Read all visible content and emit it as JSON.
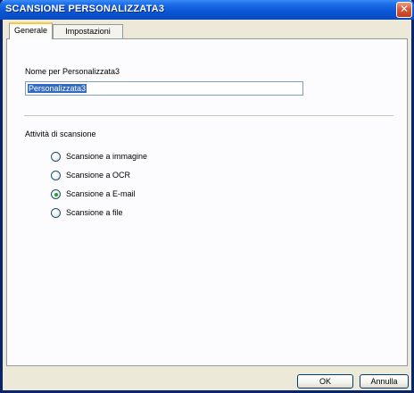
{
  "window": {
    "title": "SCANSIONE PERSONALIZZATA3",
    "close_symbol": "✕"
  },
  "tabs": [
    {
      "label": "Generale",
      "active": true
    },
    {
      "label": "Impostazioni",
      "active": false
    }
  ],
  "name_field": {
    "label": "Nome per Personalizzata3",
    "value": "Personalizzata3"
  },
  "activity": {
    "heading": "Attività di scansione",
    "options": [
      {
        "label": "Scansione a immagine",
        "selected": false
      },
      {
        "label": "Scansione a OCR",
        "selected": false
      },
      {
        "label": "Scansione a E-mail",
        "selected": true
      },
      {
        "label": "Scansione a file",
        "selected": false
      }
    ]
  },
  "buttons": {
    "ok": "OK",
    "cancel": "Annulla"
  },
  "colors": {
    "titlebar": "#0b57d8",
    "dialog_bg": "#ece9d8",
    "selection": "#316ac5",
    "radio_dot": "#21a121",
    "active_tab_accent": "#ffc83c"
  }
}
